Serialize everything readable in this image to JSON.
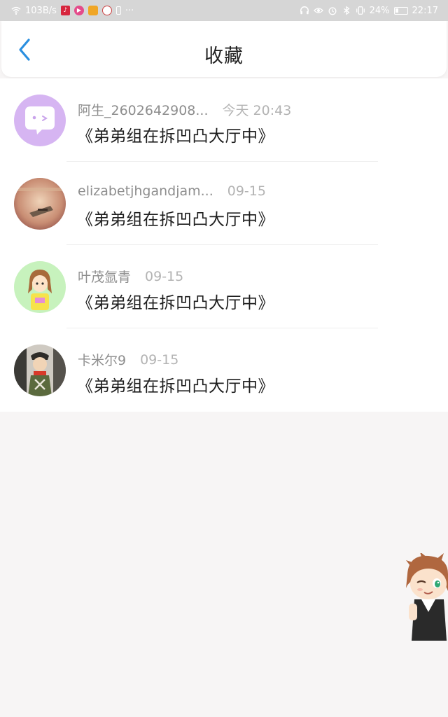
{
  "status_bar": {
    "speed": "103B/s",
    "dots": "···",
    "battery": "24%",
    "time": "22:17"
  },
  "header": {
    "title": "收藏",
    "back_icon": "chevron-left-icon",
    "accent": "#2a8fe0"
  },
  "items": [
    {
      "user": "阿生_2602642908...",
      "time": "今天 20:43",
      "content": "《弟弟组在拆凹凸大厅中》"
    },
    {
      "user": "elizabetjhgandjam...",
      "time": "09-15",
      "content": "《弟弟组在拆凹凸大厅中》"
    },
    {
      "user": "叶茂氩青",
      "time": "09-15",
      "content": "《弟弟组在拆凹凸大厅中》"
    },
    {
      "user": "卡米尔9",
      "time": "09-15",
      "content": "《弟弟组在拆凹凸大厅中》"
    }
  ]
}
